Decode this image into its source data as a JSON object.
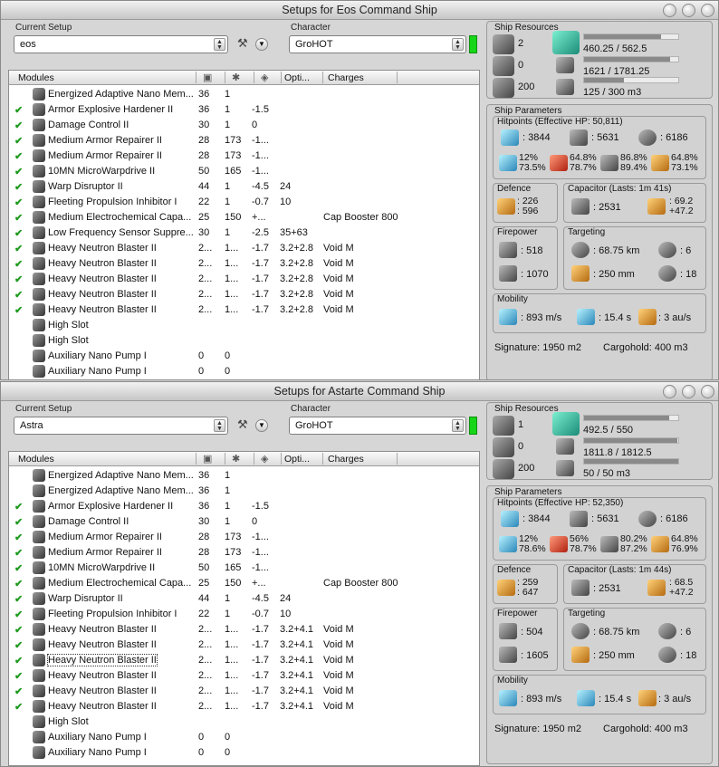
{
  "windows": [
    {
      "title": "Setups for Eos Command Ship",
      "setup_label": "Current Setup",
      "setup_value": "eos",
      "character_label": "Character",
      "character_value": "GroHOT",
      "columns": {
        "modules": "Modules",
        "optimal": "Opti...",
        "charges": "Charges"
      },
      "rows": [
        {
          "check": false,
          "name": "Energized Adaptive Nano Mem...",
          "cpu": "36",
          "pg": "1",
          "cap": "",
          "opt": "",
          "charge": ""
        },
        {
          "check": true,
          "name": "Armor Explosive Hardener II",
          "cpu": "36",
          "pg": "1",
          "cap": "-1.5",
          "opt": "",
          "charge": ""
        },
        {
          "check": true,
          "name": "Damage Control II",
          "cpu": "30",
          "pg": "1",
          "cap": "0",
          "opt": "",
          "charge": ""
        },
        {
          "check": true,
          "name": "Medium Armor Repairer II",
          "cpu": "28",
          "pg": "173",
          "cap": "-1...",
          "opt": "",
          "charge": ""
        },
        {
          "check": true,
          "name": "Medium Armor Repairer II",
          "cpu": "28",
          "pg": "173",
          "cap": "-1...",
          "opt": "",
          "charge": ""
        },
        {
          "check": true,
          "name": "10MN MicroWarpdrive II",
          "cpu": "50",
          "pg": "165",
          "cap": "-1...",
          "opt": "",
          "charge": ""
        },
        {
          "check": true,
          "name": "Warp Disruptor II",
          "cpu": "44",
          "pg": "1",
          "cap": "-4.5",
          "opt": "24",
          "charge": ""
        },
        {
          "check": true,
          "name": "Fleeting Propulsion Inhibitor I",
          "cpu": "22",
          "pg": "1",
          "cap": "-0.7",
          "opt": "10",
          "charge": ""
        },
        {
          "check": true,
          "name": "Medium Electrochemical Capa...",
          "cpu": "25",
          "pg": "150",
          "cap": "+...",
          "opt": "",
          "charge": "Cap Booster 800"
        },
        {
          "check": true,
          "name": "Low Frequency Sensor Suppre...",
          "cpu": "30",
          "pg": "1",
          "cap": "-2.5",
          "opt": "35+63",
          "charge": ""
        },
        {
          "check": true,
          "name": "Heavy Neutron Blaster II",
          "cpu": "2...",
          "pg": "1...",
          "cap": "-1.7",
          "opt": "3.2+2.8",
          "charge": "Void M"
        },
        {
          "check": true,
          "name": "Heavy Neutron Blaster II",
          "cpu": "2...",
          "pg": "1...",
          "cap": "-1.7",
          "opt": "3.2+2.8",
          "charge": "Void M"
        },
        {
          "check": true,
          "name": "Heavy Neutron Blaster II",
          "cpu": "2...",
          "pg": "1...",
          "cap": "-1.7",
          "opt": "3.2+2.8",
          "charge": "Void M"
        },
        {
          "check": true,
          "name": "Heavy Neutron Blaster II",
          "cpu": "2...",
          "pg": "1...",
          "cap": "-1.7",
          "opt": "3.2+2.8",
          "charge": "Void M"
        },
        {
          "check": true,
          "name": "Heavy Neutron Blaster II",
          "cpu": "2...",
          "pg": "1...",
          "cap": "-1.7",
          "opt": "3.2+2.8",
          "charge": "Void M"
        },
        {
          "check": false,
          "name": "High Slot",
          "cpu": "",
          "pg": "",
          "cap": "",
          "opt": "",
          "charge": ""
        },
        {
          "check": false,
          "name": "High Slot",
          "cpu": "",
          "pg": "",
          "cap": "",
          "opt": "",
          "charge": ""
        },
        {
          "check": false,
          "name": "Auxiliary Nano Pump I",
          "cpu": "0",
          "pg": "0",
          "cap": "",
          "opt": "",
          "charge": ""
        },
        {
          "check": false,
          "name": "Auxiliary Nano Pump I",
          "cpu": "0",
          "pg": "0",
          "cap": "",
          "opt": "",
          "charge": ""
        }
      ],
      "resources": {
        "title": "Ship Resources",
        "turrets": "2",
        "launchers": "0",
        "calibration": "200",
        "cpu": "460.25 / 562.5",
        "cpu_fraction": 0.82,
        "powergrid": "1621 / 1781.25",
        "powergrid_fraction": 0.91,
        "drone_bay": "125 / 300 m3",
        "drone_fraction": 0.42
      },
      "params": {
        "title": "Ship Parameters",
        "hitpoints_title": "Hitpoints (Effective HP: 50,811)",
        "shield_hp": ": 3844",
        "armor_hp": ": 5631",
        "hull_hp": ": 6186",
        "res": [
          [
            "12%",
            "73.5%"
          ],
          [
            "64.8%",
            "78.7%"
          ],
          [
            "86.8%",
            "89.4%"
          ],
          [
            "64.8%",
            "73.1%"
          ]
        ],
        "defence_title": "Defence",
        "defence": [
          ": 226",
          ": 596"
        ],
        "capacitor_title": "Capacitor (Lasts: 1m 41s)",
        "capacitor": ": 2531",
        "cap_rate": [
          ": 69.2",
          "+47.2"
        ],
        "firepower_title": "Firepower",
        "firepower": [
          ": 518",
          ": 1070"
        ],
        "targeting_title": "Targeting",
        "target_range": ": 68.75 km",
        "max_targets": ": 6",
        "sig_res": ": 250 mm",
        "scan_res": ": 18",
        "mobility_title": "Mobility",
        "speed": ": 893 m/s",
        "align": ": 15.4 s",
        "warp": ": 3 au/s",
        "signature": "Signature: 1950 m2",
        "cargohold": "Cargohold: 400 m3"
      }
    },
    {
      "title": "Setups for Astarte Command Ship",
      "setup_label": "Current Setup",
      "setup_value": "Astra",
      "character_label": "Character",
      "character_value": "GroHOT",
      "columns": {
        "modules": "Modules",
        "optimal": "Opti...",
        "charges": "Charges"
      },
      "rows": [
        {
          "check": false,
          "name": "Energized Adaptive Nano Mem...",
          "cpu": "36",
          "pg": "1",
          "cap": "",
          "opt": "",
          "charge": ""
        },
        {
          "check": false,
          "name": "Energized Adaptive Nano Mem...",
          "cpu": "36",
          "pg": "1",
          "cap": "",
          "opt": "",
          "charge": ""
        },
        {
          "check": true,
          "name": "Armor Explosive Hardener II",
          "cpu": "36",
          "pg": "1",
          "cap": "-1.5",
          "opt": "",
          "charge": ""
        },
        {
          "check": true,
          "name": "Damage Control II",
          "cpu": "30",
          "pg": "1",
          "cap": "0",
          "opt": "",
          "charge": ""
        },
        {
          "check": true,
          "name": "Medium Armor Repairer II",
          "cpu": "28",
          "pg": "173",
          "cap": "-1...",
          "opt": "",
          "charge": ""
        },
        {
          "check": true,
          "name": "Medium Armor Repairer II",
          "cpu": "28",
          "pg": "173",
          "cap": "-1...",
          "opt": "",
          "charge": ""
        },
        {
          "check": true,
          "name": "10MN MicroWarpdrive II",
          "cpu": "50",
          "pg": "165",
          "cap": "-1...",
          "opt": "",
          "charge": ""
        },
        {
          "check": true,
          "name": "Medium Electrochemical Capa...",
          "cpu": "25",
          "pg": "150",
          "cap": "+...",
          "opt": "",
          "charge": "Cap Booster 800"
        },
        {
          "check": true,
          "name": "Warp Disruptor II",
          "cpu": "44",
          "pg": "1",
          "cap": "-4.5",
          "opt": "24",
          "charge": ""
        },
        {
          "check": true,
          "name": "Fleeting Propulsion Inhibitor I",
          "cpu": "22",
          "pg": "1",
          "cap": "-0.7",
          "opt": "10",
          "charge": ""
        },
        {
          "check": true,
          "name": "Heavy Neutron Blaster II",
          "cpu": "2...",
          "pg": "1...",
          "cap": "-1.7",
          "opt": "3.2+4.1",
          "charge": "Void M"
        },
        {
          "check": true,
          "name": "Heavy Neutron Blaster II",
          "cpu": "2...",
          "pg": "1...",
          "cap": "-1.7",
          "opt": "3.2+4.1",
          "charge": "Void M"
        },
        {
          "check": true,
          "name": "Heavy Neutron Blaster II",
          "cpu": "2...",
          "pg": "1...",
          "cap": "-1.7",
          "opt": "3.2+4.1",
          "charge": "Void M",
          "focused": true
        },
        {
          "check": true,
          "name": "Heavy Neutron Blaster II",
          "cpu": "2...",
          "pg": "1...",
          "cap": "-1.7",
          "opt": "3.2+4.1",
          "charge": "Void M"
        },
        {
          "check": true,
          "name": "Heavy Neutron Blaster II",
          "cpu": "2...",
          "pg": "1...",
          "cap": "-1.7",
          "opt": "3.2+4.1",
          "charge": "Void M"
        },
        {
          "check": true,
          "name": "Heavy Neutron Blaster II",
          "cpu": "2...",
          "pg": "1...",
          "cap": "-1.7",
          "opt": "3.2+4.1",
          "charge": "Void M"
        },
        {
          "check": false,
          "name": "High Slot",
          "cpu": "",
          "pg": "",
          "cap": "",
          "opt": "",
          "charge": ""
        },
        {
          "check": false,
          "name": "Auxiliary Nano Pump I",
          "cpu": "0",
          "pg": "0",
          "cap": "",
          "opt": "",
          "charge": ""
        },
        {
          "check": false,
          "name": "Auxiliary Nano Pump I",
          "cpu": "0",
          "pg": "0",
          "cap": "",
          "opt": "",
          "charge": ""
        }
      ],
      "resources": {
        "title": "Ship Resources",
        "turrets": "1",
        "launchers": "0",
        "calibration": "200",
        "cpu": "492.5 / 550",
        "cpu_fraction": 0.9,
        "powergrid": "1811.8 / 1812.5",
        "powergrid_fraction": 0.99,
        "drone_bay": "50 / 50 m3",
        "drone_fraction": 1.0
      },
      "params": {
        "title": "Ship Parameters",
        "hitpoints_title": "Hitpoints (Effective HP: 52,350)",
        "shield_hp": ": 3844",
        "armor_hp": ": 5631",
        "hull_hp": ": 6186",
        "res": [
          [
            "12%",
            "78.6%"
          ],
          [
            "56%",
            "78.7%"
          ],
          [
            "80.2%",
            "87.2%"
          ],
          [
            "64.8%",
            "76.9%"
          ]
        ],
        "defence_title": "Defence",
        "defence": [
          ": 259",
          ": 647"
        ],
        "capacitor_title": "Capacitor (Lasts: 1m 44s)",
        "capacitor": ": 2531",
        "cap_rate": [
          ": 68.5",
          "+47.2"
        ],
        "firepower_title": "Firepower",
        "firepower": [
          ": 504",
          ": 1605"
        ],
        "targeting_title": "Targeting",
        "target_range": ": 68.75 km",
        "max_targets": ": 6",
        "sig_res": ": 250 mm",
        "scan_res": ": 18",
        "mobility_title": "Mobility",
        "speed": ": 893 m/s",
        "align": ": 15.4 s",
        "warp": ": 3 au/s",
        "signature": "Signature: 1950 m2",
        "cargohold": "Cargohold: 400 m3"
      }
    }
  ],
  "colors": {
    "status_green": "#17d617",
    "check_green": "#1f9a1f"
  }
}
